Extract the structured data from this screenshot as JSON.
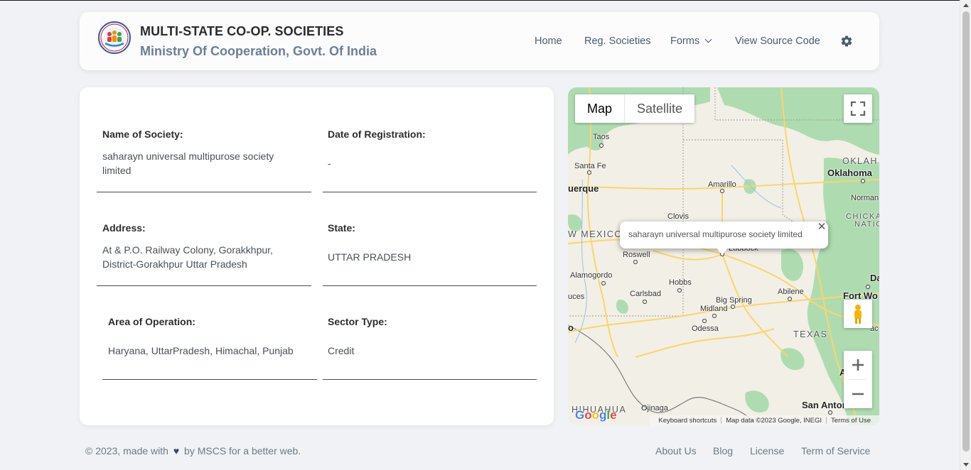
{
  "header": {
    "title": "MULTI-STATE CO-OP. SOCIETIES",
    "subtitle": "Ministry Of Cooperation, Govt. Of India",
    "logo_icon": "ministry-emblem-icon",
    "nav": {
      "home": "Home",
      "reg_societies": "Reg. Societies",
      "forms": "Forms",
      "view_source": "View Source Code"
    }
  },
  "society": {
    "name_label": "Name of Society:",
    "name_value": "saharayn universal multipurose society limited",
    "date_label": "Date of Registration:",
    "date_value": "-",
    "address_label": "Address:",
    "address_value": "At & P.O. Railway Colony, Gorakkhpur, District-Gorakhpur Uttar Pradesh",
    "state_label": "State:",
    "state_value": "UTTAR PRADESH",
    "area_label": "Area of Operation:",
    "area_value": "Haryana, UttarPradesh, Himachal, Punjab",
    "sector_label": "Sector Type:",
    "sector_value": "Credit"
  },
  "map": {
    "type_map": "Map",
    "type_satellite": "Satellite",
    "infowindow_text": "saharayn universal multipurose society limited",
    "attribution": {
      "shortcuts": "Keyboard shortcuts",
      "data": "Map data ©2023 Google, INEGI",
      "terms": "Terms of Use"
    },
    "google": [
      "G",
      "o",
      "o",
      "g",
      "l",
      "e"
    ],
    "places": {
      "taos": "Taos",
      "santa_fe": "Santa Fe",
      "albuquerque": "uerque",
      "new_mexico": "W MEXICO",
      "clovis": "Clovis",
      "amarillo": "Amarillo",
      "roswell": "Roswell",
      "lubbock": "Lubbock",
      "alamogordo": "Alamogordo",
      "las_cruces": "uces",
      "carlsbad": "Carlsbad",
      "hobbs": "Hobbs",
      "big_spring": "Big Spring",
      "midland": "Midland",
      "odessa": "Odessa",
      "abilene": "Abilene",
      "texas": "TEXAS",
      "el_paso": "o",
      "chihuahua": "HIHUAHUA",
      "ojinaga": "Ojinaga",
      "san_antonio": "San Anton",
      "oklahoma_state": "OKLAH",
      "oklahoma_city": "Oklahoma",
      "norman": "Norman",
      "chickasaw": "CHICKAS",
      "nation": "NATIO",
      "dallas": "Da",
      "fort_worth": "Fort Wo",
      "waco": "ac",
      "austin": "A"
    }
  },
  "footer": {
    "copyright_pre": "© 2023, made with",
    "copyright_post": "by MSCS for a better web.",
    "links": {
      "about": "About Us",
      "blog": "Blog",
      "license": "License",
      "terms": "Term of Service"
    }
  },
  "colors": {
    "background": "#f0f2f5",
    "card": "#ffffff",
    "brand_sub": "#6c7f93",
    "map_land": "#f2efe6",
    "map_green": "#aedcb0",
    "map_highway": "#fbd56b"
  }
}
